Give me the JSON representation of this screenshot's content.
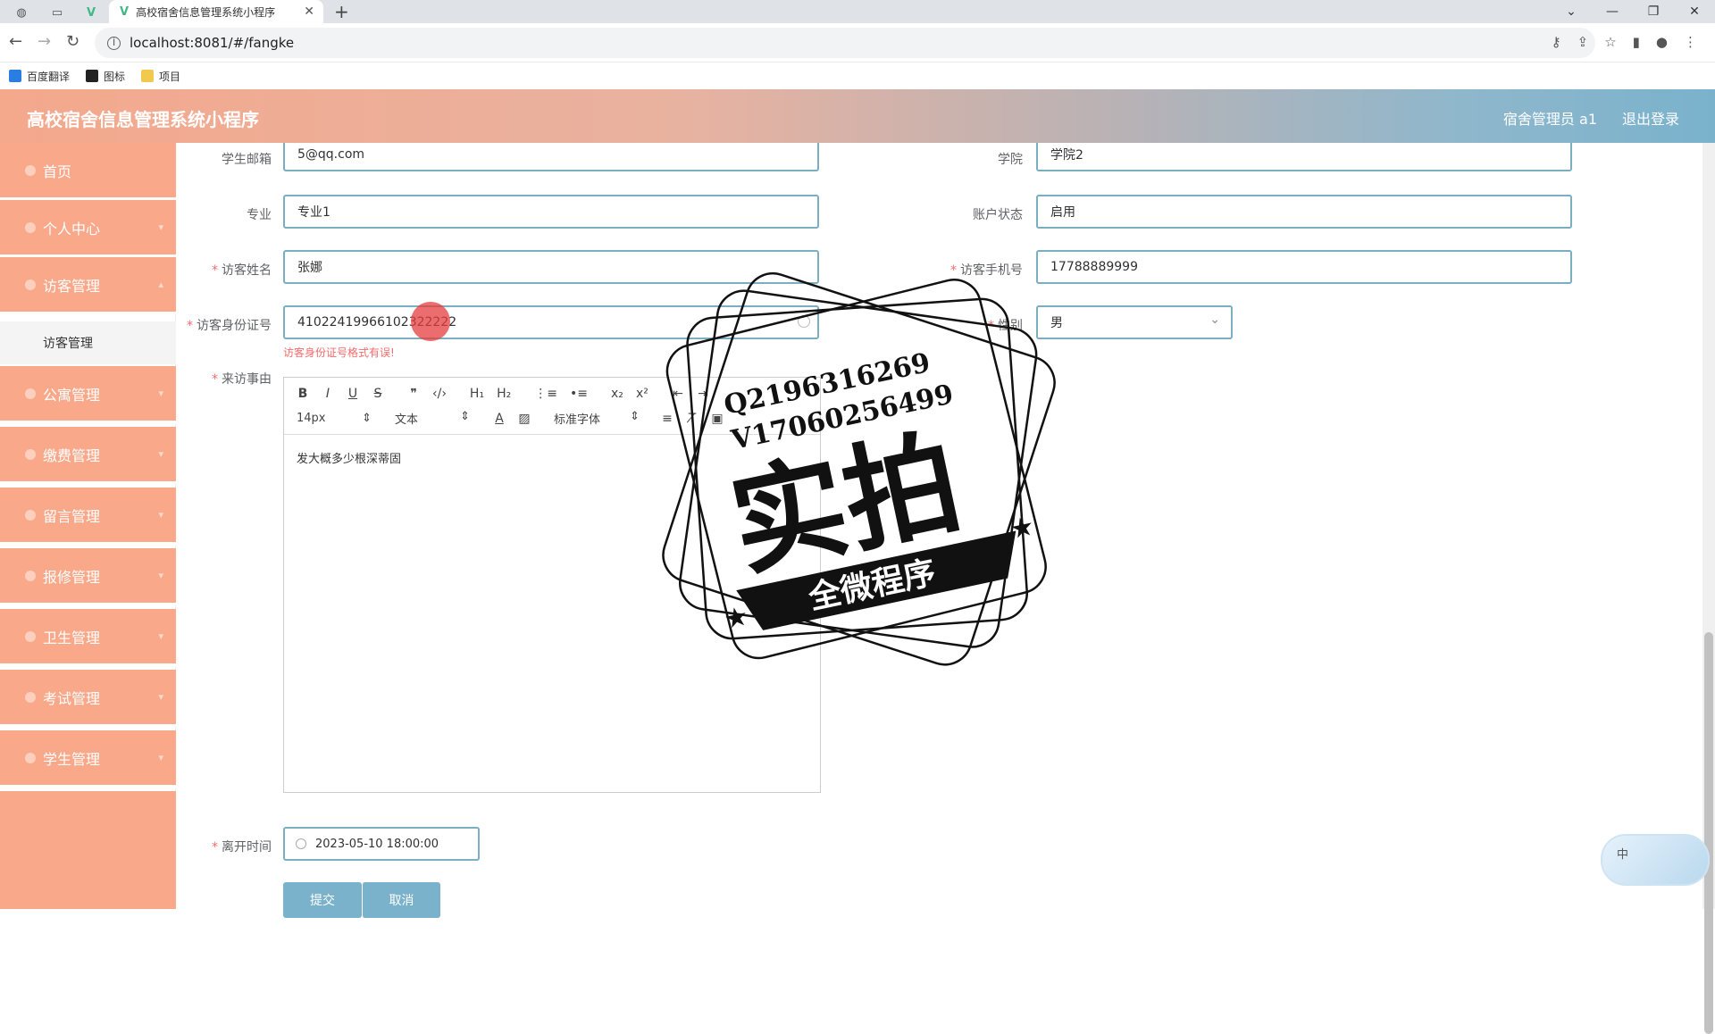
{
  "browser": {
    "tab_title": "高校宿舍信息管理系统小程序",
    "url": "localhost:8081/#/fangke",
    "bookmarks": [
      "百度翻译",
      "图标",
      "项目"
    ]
  },
  "header": {
    "title": "高校宿舍信息管理系统小程序",
    "user": "宿舍管理员 a1",
    "logout": "退出登录"
  },
  "sidebar": {
    "items": [
      "首页",
      "个人中心",
      "访客管理",
      "公寓管理",
      "缴费管理",
      "留言管理",
      "报修管理",
      "卫生管理",
      "考试管理",
      "学生管理"
    ],
    "sub_item": "访客管理"
  },
  "form": {
    "email_label": "学生邮箱",
    "email_value": "5@qq.com",
    "college_label": "学院",
    "college_value": "学院2",
    "major_label": "专业",
    "major_value": "专业1",
    "status_label": "账户状态",
    "status_value": "启用",
    "visitor_name_label": "访客姓名",
    "visitor_name_value": "张娜",
    "visitor_phone_label": "访客手机号",
    "visitor_phone_value": "17788889999",
    "visitor_id_label": "访客身份证号",
    "visitor_id_value": "41022419966102322222",
    "visitor_id_error": "访客身份证号格式有误!",
    "gender_label": "性别",
    "gender_value": "男",
    "reason_label": "来访事由",
    "reason_value": "发大概多少根深蒂固",
    "leave_time_label": "离开时间",
    "leave_time_value": "2023-05-10 18:00:00",
    "submit": "提交",
    "cancel": "取消"
  },
  "editor_toolbar": {
    "font_size": "14px",
    "block": "文本",
    "font_family": "标准字体"
  },
  "watermark": {
    "line1": "Q2196316269",
    "line2": "V17060256499",
    "big": "实拍",
    "banner": "全微程序"
  },
  "ime": {
    "label": "中"
  }
}
